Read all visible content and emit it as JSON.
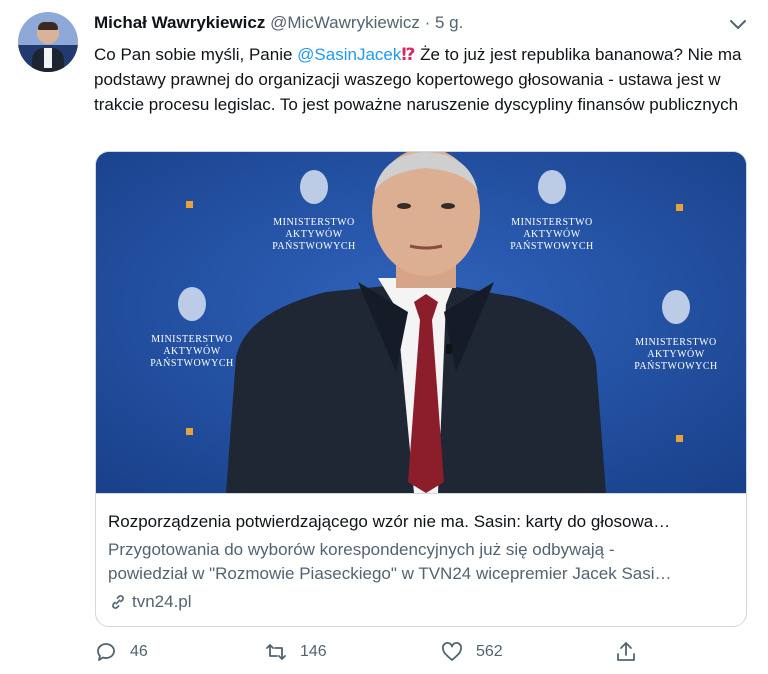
{
  "tweet": {
    "author_name": "Michał Wawrykiewicz",
    "author_handle": "@MicWawrykiewicz",
    "separator": "·",
    "time": "5 g.",
    "text_part1": "Co Pan sobie myśli, Panie ",
    "mention": "@SasinJacek",
    "emoji": "⁉",
    "text_part2": " Że to już jest republika bananowa? Nie ma podstawy prawnej do organizacji waszego kopertowego głosowania - ustawa jest w trakcie procesu legislac. To jest poważne naruszenie dyscypliny finansów publicznych"
  },
  "card": {
    "media_signs": [
      "MINISTERSTWO",
      "AKTYWÓW",
      "PAŃSTWOWYCH"
    ],
    "title": "Rozporządzenia potwierdzającego wzór nie ma. Sasin: karty do głosowa…",
    "desc_line1": "Przygotowania do wyborów korespondencyjnych już się odbywają -",
    "desc_line2": "powiedział w \"Rozmowie Piaseckiego\" w TVN24 wicepremier Jacek Sasi…",
    "domain": "tvn24.pl"
  },
  "actions": {
    "reply_count": "46",
    "retweet_count": "146",
    "like_count": "562"
  },
  "colors": {
    "accent": "#1d9bf0",
    "muted": "#536471",
    "media_background": "#1f4ea0",
    "tie": "#8b1e2a"
  }
}
